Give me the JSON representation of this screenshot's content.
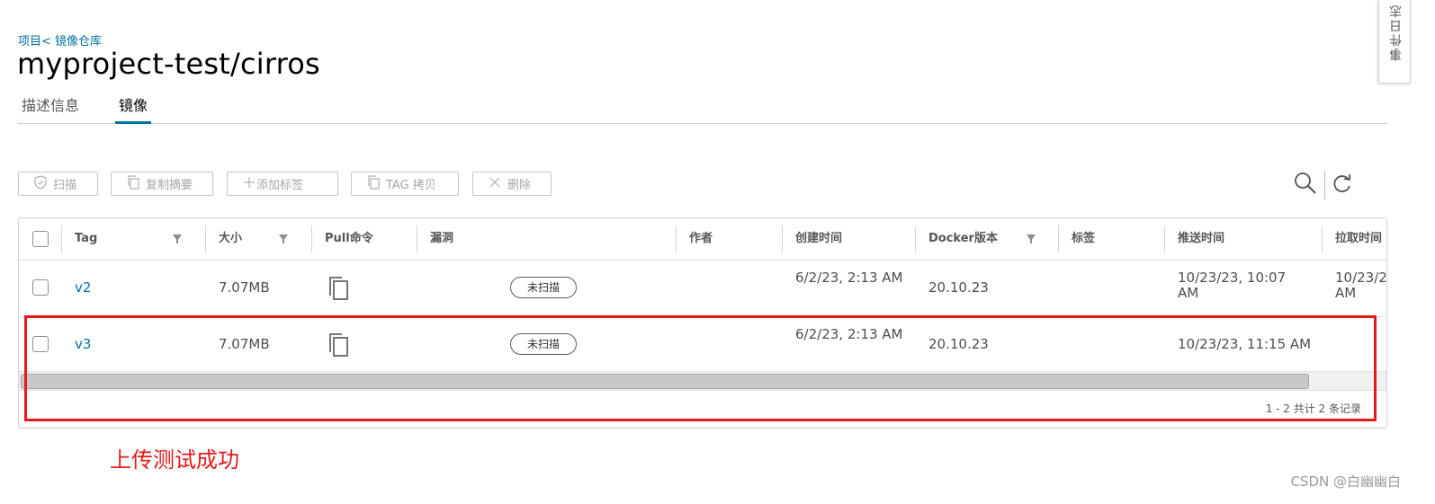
{
  "breadcrumb": "项目< 镜像仓库",
  "title": "myproject-test/cirros",
  "tabs": [
    {
      "label": "描述信息",
      "active": false
    },
    {
      "label": "镜像",
      "active": true
    }
  ],
  "toolbar": {
    "scan": "扫描",
    "copy_digest": "复制摘要",
    "add_tag": "添加标签",
    "tag_copy": "TAG 拷贝",
    "delete": "删除"
  },
  "table": {
    "columns": [
      "Tag",
      "大小",
      "Pull命令",
      "漏洞",
      "作者",
      "创建时间",
      "Docker版本",
      "标签",
      "推送时间",
      "拉取时间"
    ],
    "rows": [
      {
        "tag": "v2",
        "size": "7.07MB",
        "vuln": "未扫描",
        "author": "",
        "created": "6/2/23, 2:13 AM",
        "docker": "20.10.23",
        "labels": "",
        "pushed": "10/23/23, 10:07 AM",
        "pulled": "10/23/2 AM"
      },
      {
        "tag": "v3",
        "size": "7.07MB",
        "vuln": "未扫描",
        "author": "",
        "created": "6/2/23, 2:13 AM",
        "docker": "20.10.23",
        "labels": "",
        "pushed": "10/23/23, 11:15 AM",
        "pulled": ""
      }
    ],
    "footer": "1 - 2 共计 2 条记录"
  },
  "annotation": "上传测试成功",
  "side_tab": "事件日志",
  "watermark": "CSDN @白幽幽白",
  "colors": {
    "accent": "#0072a3",
    "highlight": "#e6191a"
  }
}
